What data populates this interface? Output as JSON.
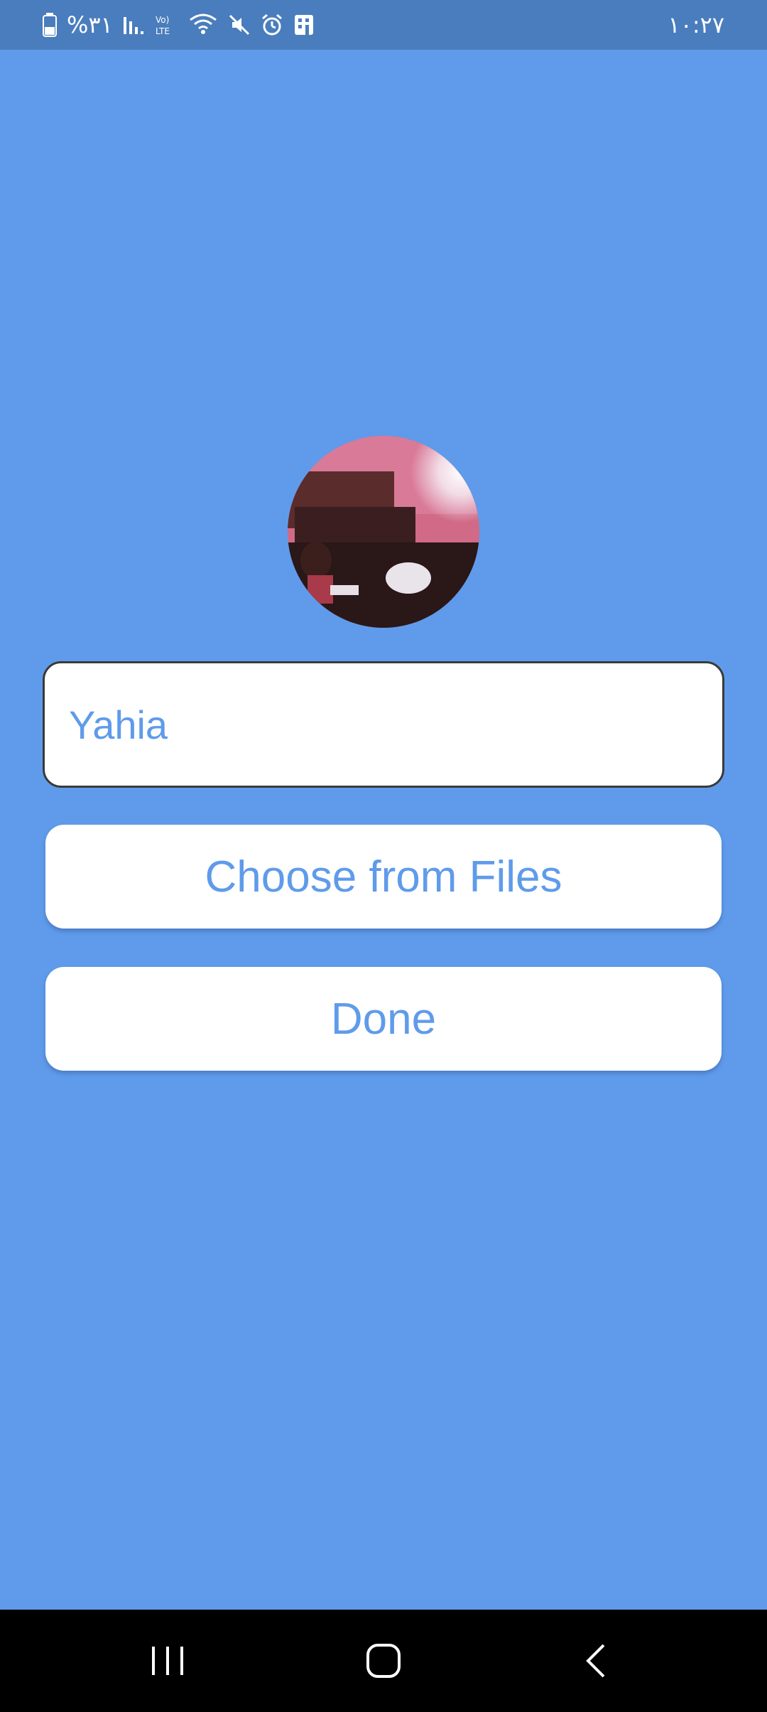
{
  "status_bar": {
    "battery_percent": "%٣١",
    "time": "١٠:٢٧",
    "icons": [
      "battery-icon",
      "signal-icon",
      "volte-icon",
      "wifi-icon",
      "mute-icon",
      "alarm-icon",
      "building-icon"
    ]
  },
  "profile": {
    "avatar_alt": "profile-photo",
    "name_value": "Yahia"
  },
  "buttons": {
    "choose_label": "Choose from Files",
    "done_label": "Done"
  },
  "nav_bar": {
    "icons": [
      "recents-icon",
      "home-icon",
      "back-icon"
    ]
  },
  "colors": {
    "background": "#5f9bea",
    "status_bar": "#4a7dbd",
    "button_text": "#5f9bea",
    "nav_bar": "#000000"
  }
}
